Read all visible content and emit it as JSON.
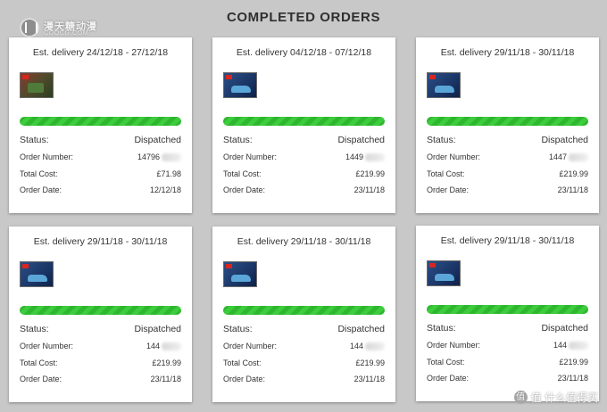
{
  "page": {
    "title": "COMPLETED ORDERS"
  },
  "logo": {
    "text_cn": "漫天糖动漫",
    "text_en": "COOCG.COM"
  },
  "labels": {
    "status": "Status:",
    "order_number": "Order Number:",
    "total_cost": "Total Cost:",
    "order_date": "Order Date:"
  },
  "orders": [
    {
      "delivery": "Est. delivery 24/12/18 - 27/12/18",
      "status": "Dispatched",
      "order_number": "14796",
      "total_cost": "£71.98",
      "order_date": "12/12/18",
      "product_icon": "green-truck-set-icon",
      "progress": 1.0
    },
    {
      "delivery": "Est. delivery 04/12/18 - 07/12/18",
      "status": "Dispatched",
      "order_number": "1449",
      "total_cost": "£219.99",
      "order_date": "23/11/18",
      "product_icon": "blue-car-set-icon",
      "progress": 1.0
    },
    {
      "delivery": "Est. delivery 29/11/18 - 30/11/18",
      "status": "Dispatched",
      "order_number": "1447",
      "total_cost": "£219.99",
      "order_date": "23/11/18",
      "product_icon": "blue-car-set-icon",
      "progress": 1.0
    },
    {
      "delivery": "Est. delivery 29/11/18 - 30/11/18",
      "status": "Dispatched",
      "order_number": "144",
      "total_cost": "£219.99",
      "order_date": "23/11/18",
      "product_icon": "blue-car-set-icon",
      "progress": 1.0
    },
    {
      "delivery": "Est. delivery 29/11/18 - 30/11/18",
      "status": "Dispatched",
      "order_number": "144",
      "total_cost": "£219.99",
      "order_date": "23/11/18",
      "product_icon": "blue-car-set-icon",
      "progress": 1.0
    },
    {
      "delivery": "Est. delivery 29/11/18 - 30/11/18",
      "status": "Dispatched",
      "order_number": "144",
      "total_cost": "£219.99",
      "order_date": "23/11/18",
      "product_icon": "blue-car-set-icon",
      "progress": 1.0
    }
  ],
  "watermark": {
    "text": "值 什么值得买"
  },
  "colors": {
    "progress": "#2fb62f",
    "background": "#c8c8c8",
    "card": "#ffffff"
  }
}
